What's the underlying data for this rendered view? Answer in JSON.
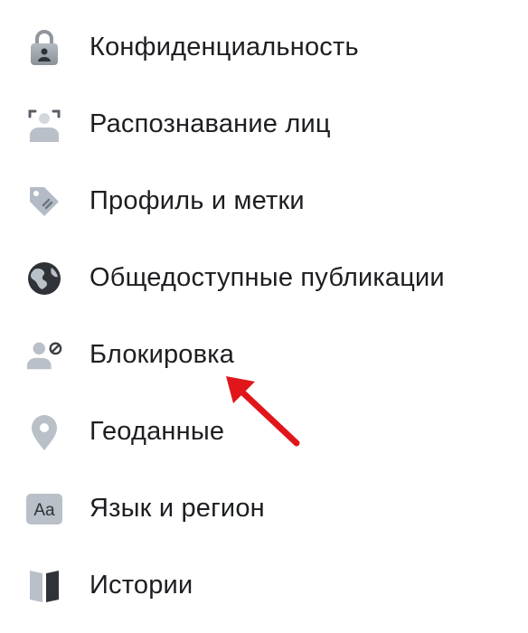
{
  "settings_menu": {
    "items": [
      {
        "label": "Конфиденциальность",
        "icon": "lock-icon"
      },
      {
        "label": "Распознавание лиц",
        "icon": "face-recognition-icon"
      },
      {
        "label": "Профиль и метки",
        "icon": "tag-icon"
      },
      {
        "label": "Общедоступные публикации",
        "icon": "globe-icon"
      },
      {
        "label": "Блокировка",
        "icon": "user-blocked-icon"
      },
      {
        "label": "Геоданные",
        "icon": "location-pin-icon"
      },
      {
        "label": "Язык и регион",
        "icon": "language-icon"
      },
      {
        "label": "Истории",
        "icon": "book-icon"
      }
    ]
  },
  "icon_labels": {
    "language": "Aa"
  },
  "colors": {
    "icon_gray": "#8a9199",
    "icon_dark": "#4b5158",
    "text": "#1c1e21",
    "arrow": "#e0161b"
  }
}
